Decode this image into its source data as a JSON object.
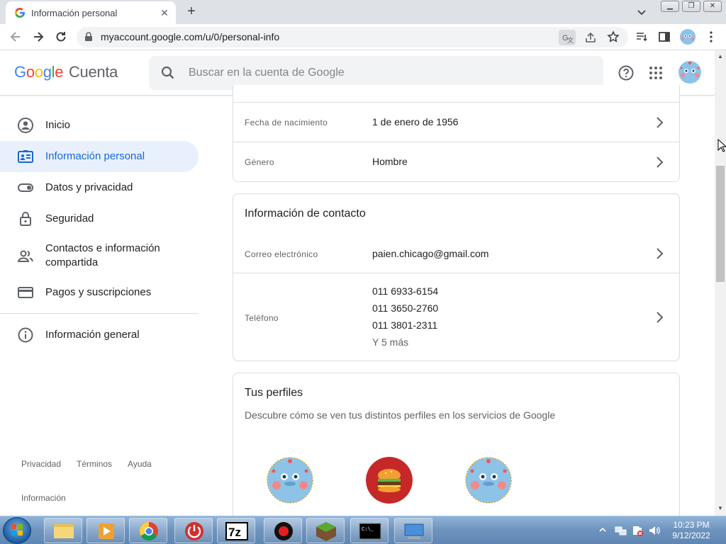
{
  "browser": {
    "tab_title": "Información personal",
    "url": "myaccount.google.com/u/0/personal-info"
  },
  "header": {
    "logo_parts": [
      "G",
      "o",
      "o",
      "g",
      "l",
      "e"
    ],
    "product": "Cuenta",
    "search_placeholder": "Buscar en la cuenta de Google"
  },
  "sidebar": {
    "items": [
      {
        "label": "Inicio",
        "icon": "home-icon"
      },
      {
        "label": "Información personal",
        "icon": "id-card-icon",
        "active": true
      },
      {
        "label": "Datos y privacidad",
        "icon": "toggle-icon"
      },
      {
        "label": "Seguridad",
        "icon": "lock-icon"
      },
      {
        "label_line1": "Contactos e información",
        "label_line2": "compartida",
        "icon": "people-icon"
      },
      {
        "label": "Pagos y suscripciones",
        "icon": "credit-card-icon"
      },
      {
        "label": "Información general",
        "icon": "info-icon"
      }
    ],
    "footer_links": [
      "Privacidad",
      "Términos",
      "Ayuda"
    ],
    "footer_info": "Información"
  },
  "basic_info": {
    "rows": [
      {
        "label": "Fecha de nacimiento",
        "value": "1 de enero de 1956"
      },
      {
        "label": "Género",
        "value": "Hombre"
      }
    ]
  },
  "contact": {
    "title": "Información de contacto",
    "email_label": "Correo electrónico",
    "email_value": "paien.chicago@gmail.com",
    "phone_label": "Teléfono",
    "phones": [
      "011 6933-6154",
      "011 3650-2760",
      "011 3801-2311"
    ],
    "more": "Y 5 más"
  },
  "profiles": {
    "title": "Tus perfiles",
    "subtitle": "Descubre cómo se ven tus distintos perfiles en los servicios de Google"
  },
  "taskbar": {
    "time": "10:23 PM",
    "date": "9/12/2022"
  },
  "colors": {
    "accent_blue": "#1967d2",
    "active_nav_bg": "#e8f0fe",
    "google_blue": "#4285f4",
    "google_red": "#ea4335",
    "google_yellow": "#fbbc05",
    "google_green": "#34a853"
  }
}
